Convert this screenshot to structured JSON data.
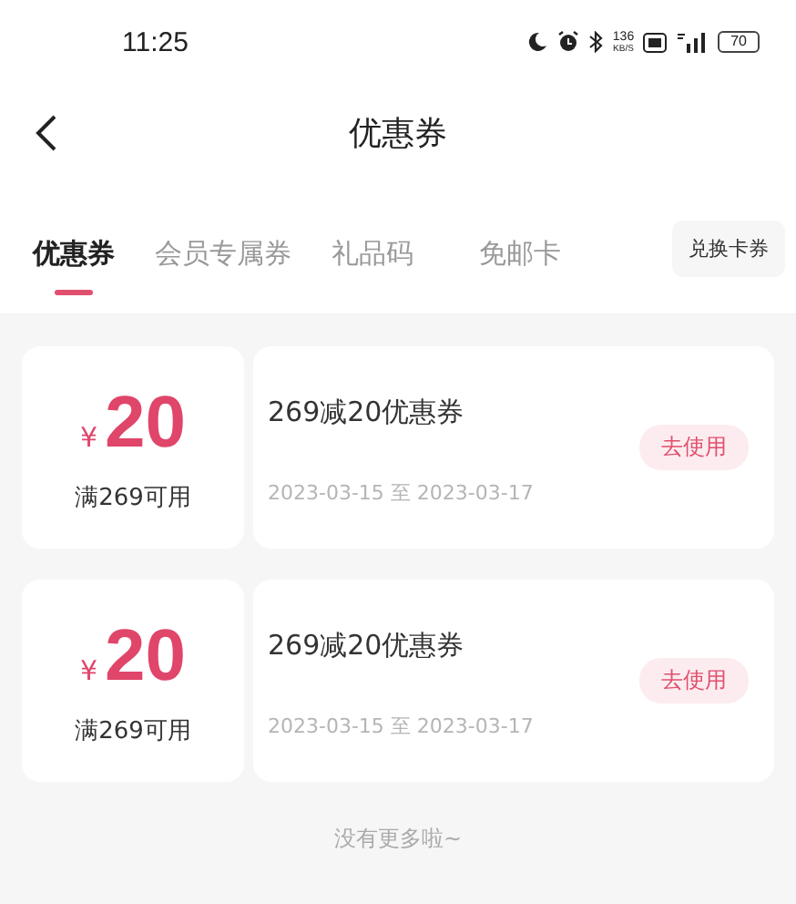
{
  "status_bar": {
    "time": "11:25",
    "net_speed": "136",
    "net_unit": "KB/S",
    "battery": "70"
  },
  "header": {
    "title": "优惠券"
  },
  "tabs": [
    {
      "label": "优惠券",
      "selected": true
    },
    {
      "label": "会员专属券",
      "selected": false
    },
    {
      "label": "礼品码",
      "selected": false
    },
    {
      "label": "免邮卡",
      "selected": false
    }
  ],
  "redeem_button": "兑换卡券",
  "coupons": [
    {
      "currency": "¥",
      "amount": "20",
      "condition": "满269可用",
      "name": "269减20优惠券",
      "validity": "2023-03-15 至 2023-03-17",
      "action": "去使用"
    },
    {
      "currency": "¥",
      "amount": "20",
      "condition": "满269可用",
      "name": "269减20优惠券",
      "validity": "2023-03-15 至 2023-03-17",
      "action": "去使用"
    }
  ],
  "footer": "没有更多啦~"
}
